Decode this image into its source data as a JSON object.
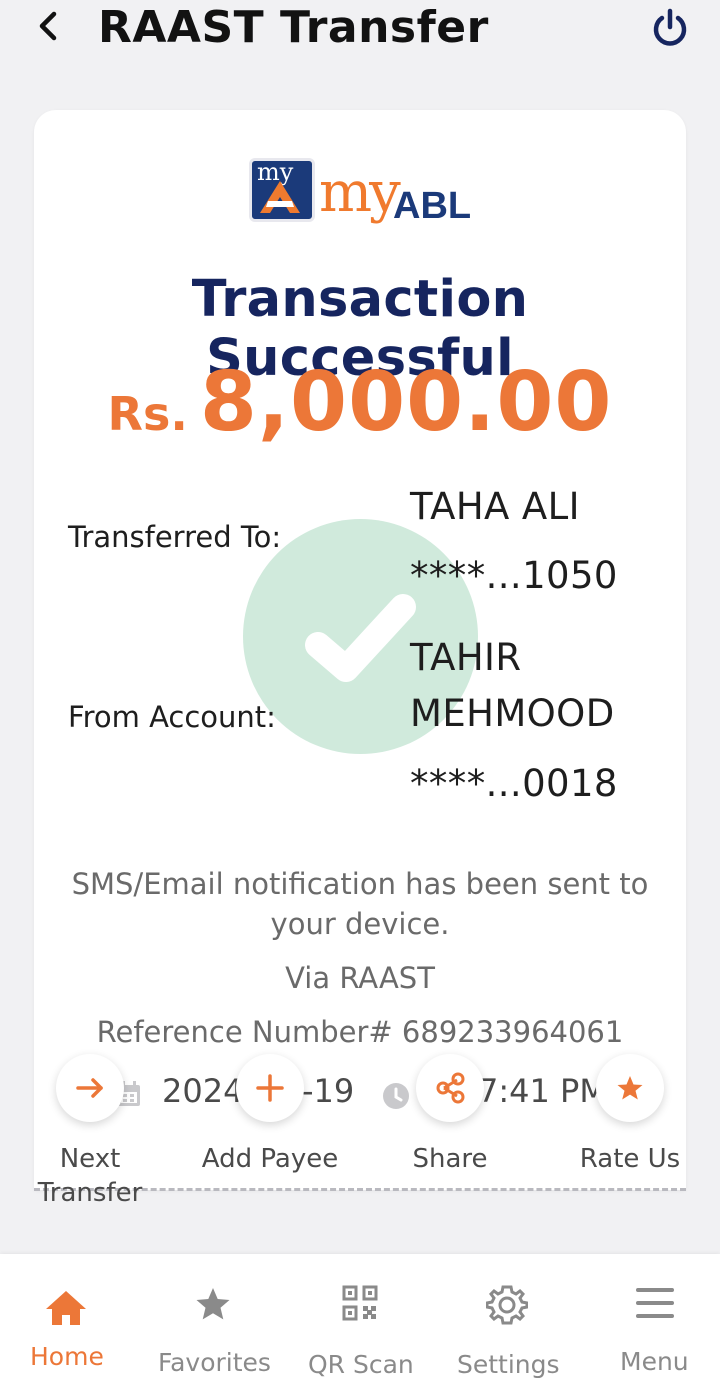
{
  "header": {
    "title": "RAAST Transfer",
    "back_icon": "chevron-left-icon",
    "power_icon": "power-icon"
  },
  "logo": {
    "badge_text": "my",
    "wordmark": "my",
    "brand": "ABL"
  },
  "receipt": {
    "status": "Transaction Successful",
    "currency": "Rs.",
    "amount": "8,000.00",
    "transferred_to_label": "Transferred To:",
    "transferred_to_name": "TAHA ALI",
    "transferred_to_account": "****...1050",
    "from_account_label": "From Account:",
    "from_name_line1": "TAHIR",
    "from_name_line2": "MEHMOOD",
    "from_account_number": "****...0018",
    "notification": "SMS/Email notification has been sent to your device.",
    "notification_line1": "SMS/Email notification has been sent to",
    "notification_line2": "your device.",
    "via": "Via RAAST",
    "reference": "Reference Number# 689233964061",
    "date_visible_a": "2024",
    "date_visible_b": "-19",
    "time_visible": "7:41 PM"
  },
  "actions": [
    {
      "label_line1": "Next",
      "label_line2": "Transfer",
      "icon": "arrow-right-icon"
    },
    {
      "label_line1": "Add Payee",
      "icon": "plus-icon"
    },
    {
      "label_line1": "Share",
      "icon": "share-icon"
    },
    {
      "label_line1": "Rate Us",
      "icon": "star-icon"
    }
  ],
  "bottom_nav": [
    {
      "label": "Home",
      "icon": "home-icon",
      "active": true
    },
    {
      "label": "Favorites",
      "icon": "star-icon",
      "active": false
    },
    {
      "label": "QR Scan",
      "icon": "qr-code-icon",
      "active": false
    },
    {
      "label": "Settings",
      "icon": "gear-icon",
      "active": false
    },
    {
      "label": "Menu",
      "icon": "hamburger-menu-icon",
      "active": false
    }
  ],
  "colors": {
    "accent": "#ec7738",
    "navy": "#16255f",
    "success_mark": "#96d0b2"
  }
}
